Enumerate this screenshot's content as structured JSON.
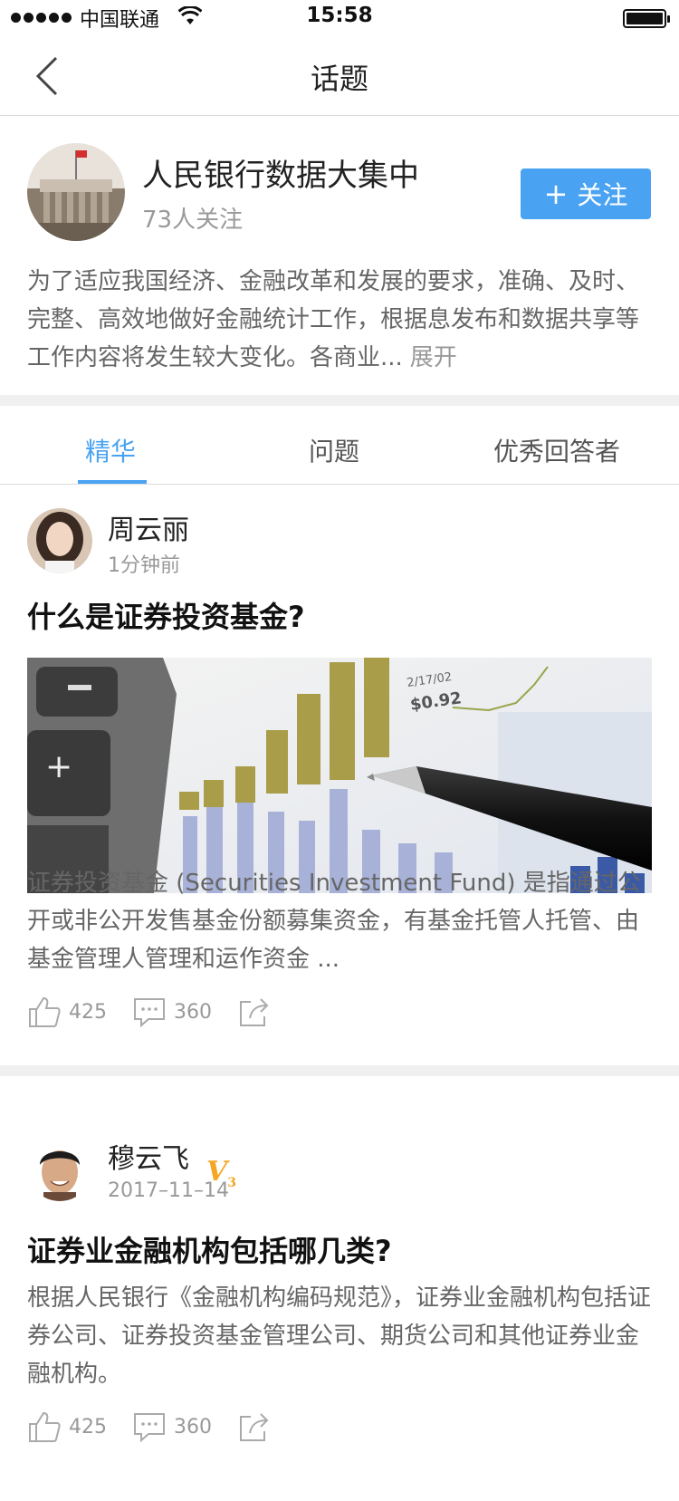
{
  "status_bar": {
    "carrier": "中国联通",
    "time": "15:58"
  },
  "nav": {
    "title": "话题"
  },
  "topic": {
    "name": "人民银行数据大集中",
    "followers": "73人关注",
    "follow_label": "关注",
    "description": "为了适应我国经济、金融改革和发展的要求，准确、及时、完整、高效地做好金融统计工作，根据息发布和数据共享等工作内容将发生较大变化。各商业...",
    "expand_label": "展开"
  },
  "tabs": [
    {
      "label": "精华",
      "active": true
    },
    {
      "label": "问题",
      "active": false
    },
    {
      "label": "优秀回答者",
      "active": false
    }
  ],
  "posts": [
    {
      "author": "周云丽",
      "time": "1分钟前",
      "title": "什么是证券投资基金?",
      "excerpt": "证券投资基金 (Securities Investment Fund) 是指通过公开或非公开发售基金份额募集资金，有基金托管人托管、由基金管理人管理和运作资金 ...",
      "likes": "425",
      "comments": "360"
    },
    {
      "author": "穆云飞",
      "badge": "V3",
      "time": "2017–11–14",
      "title": "证券业金融机构包括哪几类?",
      "excerpt": "根据人民银行《金融机构编码规范》，证券业金融机构包括证券公司、证券投资基金管理公司、期货公司和其他证券业金融机构。",
      "likes": "425",
      "comments": "360"
    }
  ],
  "image_labels": {
    "price": "$0.92",
    "date": "2/17/02",
    "axis": "10"
  },
  "colors": {
    "accent": "#4aa3f2",
    "badge": "#f5a623",
    "text_muted": "#999999"
  }
}
